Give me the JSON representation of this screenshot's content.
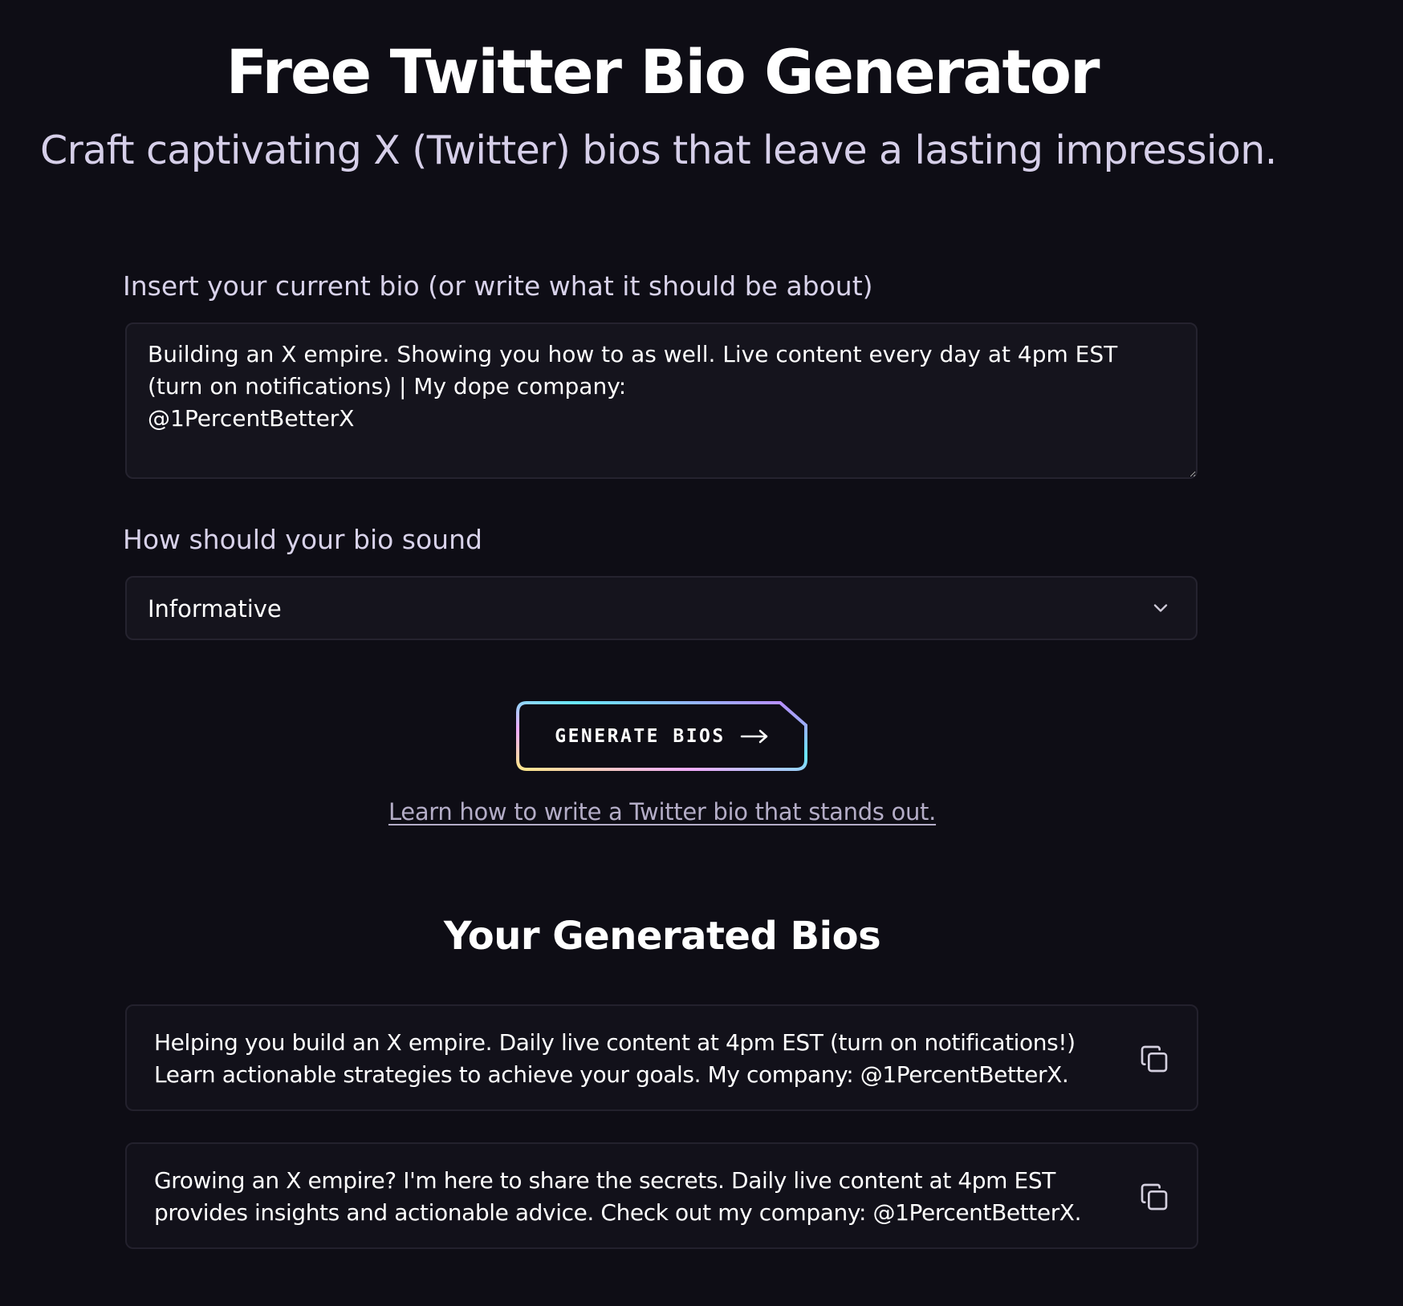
{
  "hero": {
    "title": "Free Twitter Bio Generator",
    "subtitle": "Craft captivating X (Twitter) bios that leave a lasting impression."
  },
  "form": {
    "bio_label": "Insert your current bio (or write what it should be about)",
    "bio_value": "Building an X empire. Showing you how to as well. Live content every day at 4pm EST (turn on notifications) | My dope company:\n@1PercentBetterX",
    "tone_label": "How should your bio sound",
    "tone_selected": "Informative",
    "generate_label": "GENERATE BIOS",
    "learn_link": "Learn how to write a Twitter bio that stands out."
  },
  "results": {
    "heading": "Your Generated Bios",
    "bios": [
      {
        "text": "Helping you build an X empire. Daily live content at 4pm EST (turn on notifications!) Learn actionable strategies to achieve your goals. My company: @1PercentBetterX.",
        "copy_icon": "copy-icon"
      },
      {
        "text": "Growing an X empire? I'm here to share the secrets. Daily live content at 4pm EST provides insights and actionable advice. Check out my company: @1PercentBetterX.",
        "copy_icon": "copy-icon"
      }
    ]
  },
  "icons": {
    "select_chevron": "chevron-down-icon",
    "button_arrow": "arrow-right-icon"
  },
  "colors": {
    "background": "#0e0d15",
    "input_background": "#15141d",
    "subtitle": "#d6cfe9",
    "link": "#b4adc7",
    "button_gradient": [
      "#67e8f9",
      "#c084fc",
      "#fde68a"
    ]
  }
}
